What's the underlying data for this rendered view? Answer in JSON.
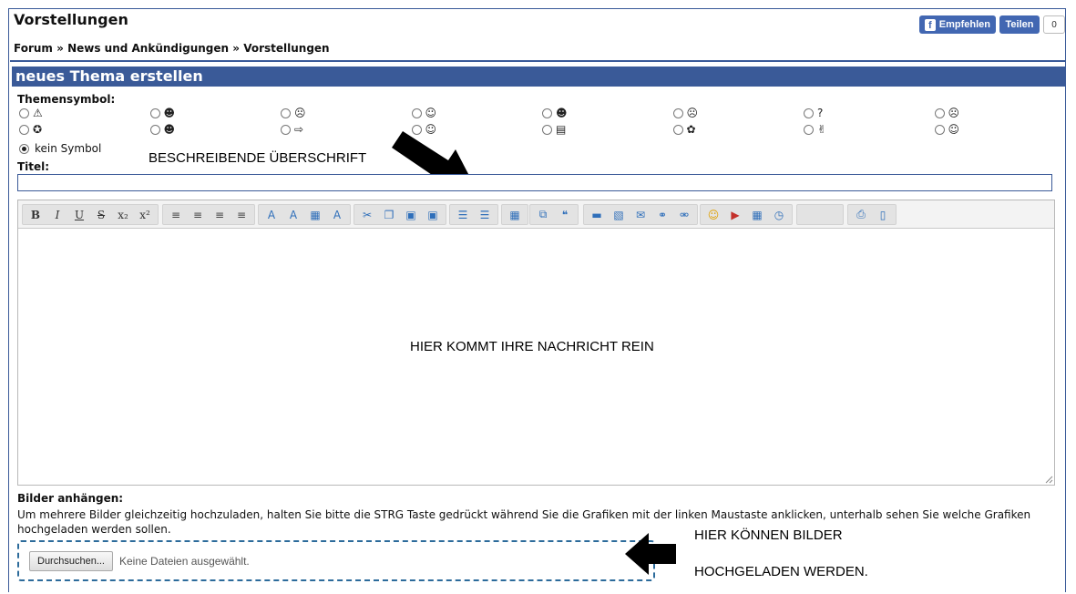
{
  "page": {
    "title": "Vorstellungen",
    "breadcrumb": [
      "Forum",
      "News und Ankündigungen",
      "Vorstellungen"
    ],
    "breadcrumb_sep": "»"
  },
  "social": {
    "like_label": "Empfehlen",
    "share_label": "Teilen",
    "count": "0",
    "fb_letter": "f"
  },
  "form": {
    "section_title": "neues Thema erstellen",
    "icon_label": "Themensymbol:",
    "icons_row1": [
      {
        "name": "warning-icon",
        "glyph": "⚠"
      },
      {
        "name": "cool-smiley-icon",
        "glyph": "☻"
      },
      {
        "name": "angry-smiley-icon",
        "glyph": "☹"
      },
      {
        "name": "laughing-smiley-icon",
        "glyph": "☺"
      },
      {
        "name": "grinning-smiley-icon",
        "glyph": "☻"
      },
      {
        "name": "shocked-smiley-icon",
        "glyph": "☹"
      },
      {
        "name": "question-icon",
        "glyph": "?"
      },
      {
        "name": "sad-smiley-icon",
        "glyph": "☹"
      }
    ],
    "icons_row2": [
      {
        "name": "lightbulb-icon",
        "glyph": "✪"
      },
      {
        "name": "big-grin-icon",
        "glyph": "☻"
      },
      {
        "name": "arrow-right-icon",
        "glyph": "⇨"
      },
      {
        "name": "smiley-icon",
        "glyph": "☺"
      },
      {
        "name": "note-icon",
        "glyph": "▤"
      },
      {
        "name": "teddy-icon",
        "glyph": "✿"
      },
      {
        "name": "thumbs-up-icon",
        "glyph": "✌"
      },
      {
        "name": "happy-smiley-icon",
        "glyph": "☺"
      }
    ],
    "no_symbol_label": "kein Symbol",
    "title_label": "Titel:",
    "title_value": "",
    "attach_label": "Bilder anhängen:",
    "attach_hint": "Um mehrere Bilder gleichzeitig hochzuladen, halten Sie bitte die STRG Taste gedrückt während Sie die Grafiken mit der linken Maustaste anklicken, unterhalb sehen Sie welche Grafiken hochgeladen werden sollen.",
    "browse_label": "Durchsuchen...",
    "no_file_text": "Keine Dateien ausgewählt."
  },
  "toolbar": {
    "groups": [
      [
        {
          "name": "bold-button",
          "glyph": "B"
        },
        {
          "name": "italic-button",
          "glyph": "I"
        },
        {
          "name": "underline-button",
          "glyph": "U"
        },
        {
          "name": "strikethrough-button",
          "glyph": "S"
        },
        {
          "name": "subscript-button",
          "glyph": "x₂"
        },
        {
          "name": "superscript-button",
          "glyph": "x²"
        }
      ],
      [
        {
          "name": "align-left-button",
          "glyph": "≡"
        },
        {
          "name": "align-center-button",
          "glyph": "≡"
        },
        {
          "name": "align-right-button",
          "glyph": "≡"
        },
        {
          "name": "justify-button",
          "glyph": "≡"
        }
      ],
      [
        {
          "name": "font-button",
          "glyph": "A"
        },
        {
          "name": "font-size-button",
          "glyph": "A"
        },
        {
          "name": "color-button",
          "glyph": "▦"
        },
        {
          "name": "remove-format-button",
          "glyph": "A"
        }
      ],
      [
        {
          "name": "cut-button",
          "glyph": "✂"
        },
        {
          "name": "copy-button",
          "glyph": "❐"
        },
        {
          "name": "paste-button",
          "glyph": "▣"
        },
        {
          "name": "paste-text-button",
          "glyph": "▣"
        }
      ],
      [
        {
          "name": "bullet-list-button",
          "glyph": "☰"
        },
        {
          "name": "numbered-list-button",
          "glyph": "☰"
        }
      ],
      [
        {
          "name": "table-button",
          "glyph": "▦"
        }
      ],
      [
        {
          "name": "code-button",
          "glyph": "⧉"
        },
        {
          "name": "quote-button",
          "glyph": "❝"
        }
      ],
      [
        {
          "name": "horizontal-rule-button",
          "glyph": "▬"
        },
        {
          "name": "image-button",
          "glyph": "▧"
        },
        {
          "name": "email-button",
          "glyph": "✉"
        },
        {
          "name": "link-button",
          "glyph": "⚭"
        },
        {
          "name": "unlink-button",
          "glyph": "⚮"
        }
      ],
      [
        {
          "name": "emoticon-button",
          "glyph": "☺"
        },
        {
          "name": "youtube-button",
          "glyph": "▶"
        },
        {
          "name": "date-button",
          "glyph": "▦"
        },
        {
          "name": "time-button",
          "glyph": "◷"
        }
      ],
      [],
      [
        {
          "name": "print-button",
          "glyph": "⎙"
        },
        {
          "name": "source-button",
          "glyph": "▯"
        }
      ]
    ]
  },
  "annotations": {
    "heading_hint": "BESCHREIBENDE ÜBERSCHRIFT",
    "message_hint": "HIER KOMMT IHRE NACHRICHT REIN",
    "upload_hint_line1": "HIER KÖNNEN BILDER",
    "upload_hint_line2": "HOCHGELADEN WERDEN."
  }
}
